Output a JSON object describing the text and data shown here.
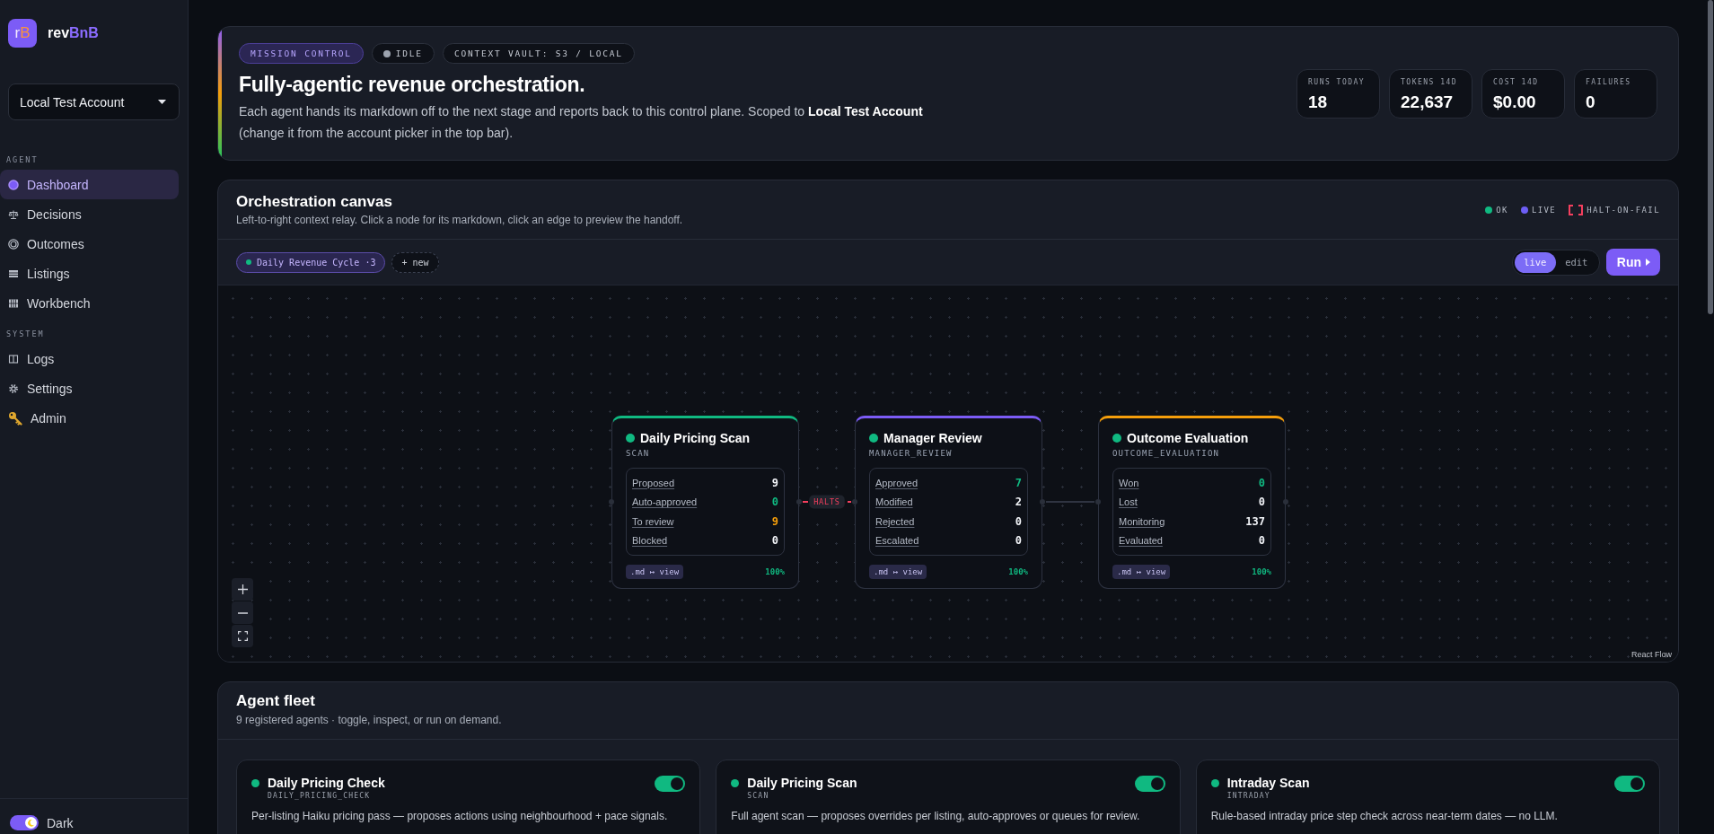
{
  "sidebar": {
    "logo_letters": [
      "r",
      "B"
    ],
    "brand": {
      "name": "rev",
      "accent": "BnB"
    },
    "account": {
      "value": "Local Test Account"
    },
    "sections": [
      {
        "label": "AGENT",
        "items": [
          {
            "label": "Dashboard",
            "selected": true
          },
          {
            "label": "Decisions",
            "selected": false
          },
          {
            "label": "Outcomes",
            "selected": false
          },
          {
            "label": "Listings",
            "selected": false
          },
          {
            "label": "Workbench",
            "selected": false
          }
        ]
      },
      {
        "label": "SYSTEM",
        "items": [
          {
            "label": "Logs",
            "selected": false
          },
          {
            "label": "Settings",
            "selected": false
          },
          {
            "label": "Admin",
            "selected": false
          }
        ]
      }
    ],
    "theme_toggle": {
      "label": "Dark",
      "on": true
    }
  },
  "header": {
    "badges": [
      {
        "label": "MISSION CONTROL",
        "kind": "accent"
      },
      {
        "label": "IDLE",
        "kind": "status"
      },
      {
        "label": "CONTEXT VAULT: S3 / LOCAL",
        "kind": "plain"
      }
    ],
    "title": "Fully-agentic revenue orchestration.",
    "description": "Each agent hands its markdown off to the next stage and reports back to this control plane. Scoped to **Local Test Account** (change it from the account picker in the top bar).",
    "stats": [
      {
        "label": "RUNS TODAY",
        "value": "18"
      },
      {
        "label": "TOKENS 14D",
        "value": "22,637"
      },
      {
        "label": "COST 14D",
        "value": "$0.00"
      },
      {
        "label": "FAILURES",
        "value": "0"
      }
    ]
  },
  "canvas": {
    "title": "Orchestration canvas",
    "subtitle": "Left-to-right context relay. Click a node for its markdown, click an edge to preview the handoff.",
    "legend": [
      {
        "label": "OK",
        "kind": "dot",
        "color": "#10b981"
      },
      {
        "label": "LIVE",
        "kind": "dot",
        "color": "#6d5ef5"
      },
      {
        "label": "HALT-ON-FAIL",
        "kind": "bracket",
        "color": "#f43f5e"
      }
    ],
    "workflows": [
      {
        "label": "Daily Revenue Cycle ·3",
        "selected": true
      }
    ],
    "new_button": "+ new",
    "modes": [
      {
        "label": "live",
        "selected": true
      },
      {
        "label": "edit",
        "selected": false
      }
    ],
    "run_button": "Run",
    "nodes": [
      {
        "title": "Daily Pricing Scan",
        "code": "SCAN",
        "color": "#10b981",
        "ok": true,
        "stats": [
          {
            "label": "Proposed",
            "value": "9",
            "color": "#f1f3f7"
          },
          {
            "label": "Auto-approved",
            "value": "0",
            "color": "#10b981"
          },
          {
            "label": "To review",
            "value": "9",
            "color": "#f59e0b"
          },
          {
            "label": "Blocked",
            "value": "0",
            "color": "#f1f3f7"
          }
        ],
        "view_button": ".md ↦ view",
        "rate": "100%"
      },
      {
        "title": "Manager Review",
        "code": "MANAGER_REVIEW",
        "color": "#7c5cf6",
        "ok": true,
        "stats": [
          {
            "label": "Approved",
            "value": "7",
            "color": "#10b981"
          },
          {
            "label": "Modified",
            "value": "2",
            "color": "#f1f3f7"
          },
          {
            "label": "Rejected",
            "value": "0",
            "color": "#f1f3f7"
          },
          {
            "label": "Escalated",
            "value": "0",
            "color": "#f1f3f7"
          }
        ],
        "view_button": ".md ↦ view",
        "rate": "100%"
      },
      {
        "title": "Outcome Evaluation",
        "code": "OUTCOME_EVALUATION",
        "color": "#f59e0b",
        "ok": true,
        "stats": [
          {
            "label": "Won",
            "value": "0",
            "color": "#10b981"
          },
          {
            "label": "Lost",
            "value": "0",
            "color": "#f1f3f7"
          },
          {
            "label": "Monitoring",
            "value": "137",
            "color": "#f1f3f7"
          },
          {
            "label": "Evaluated",
            "value": "0",
            "color": "#f1f3f7"
          }
        ],
        "view_button": ".md ↦ view",
        "rate": "100%"
      }
    ],
    "edges": [
      {
        "kind": "halt",
        "label": "HALTS"
      },
      {
        "kind": "pass"
      }
    ],
    "attribution": "React Flow"
  },
  "fleet": {
    "title": "Agent fleet",
    "subtitle": "9 registered agents · toggle, inspect, or run on demand.",
    "agents": [
      {
        "name": "Daily Pricing Check",
        "code": "DAILY_PRICING_CHECK",
        "description": "Per-listing Haiku pricing pass — proposes actions using neighbourhood + pace signals.",
        "ok": true,
        "on": true
      },
      {
        "name": "Daily Pricing Scan",
        "code": "SCAN",
        "description": "Full agent scan — proposes overrides per listing, auto-approves or queues for review.",
        "ok": true,
        "on": true
      },
      {
        "name": "Intraday Scan",
        "code": "INTRADAY",
        "description": "Rule-based intraday price step check across near-term dates — no LLM.",
        "ok": true,
        "on": true
      }
    ]
  }
}
